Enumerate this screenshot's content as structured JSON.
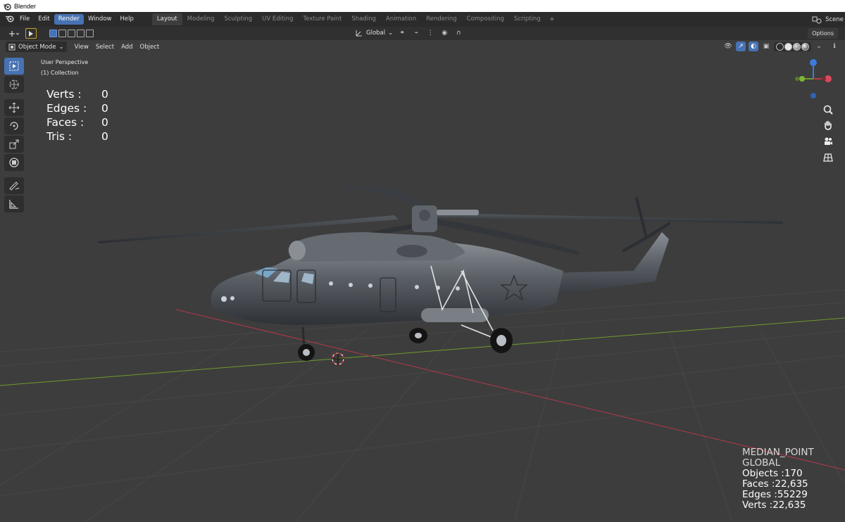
{
  "window": {
    "title": "Blender"
  },
  "topbar": {
    "menus": [
      "File",
      "Edit",
      "Render",
      "Window",
      "Help"
    ],
    "active_menu": "Render",
    "workspaces": [
      "Layout",
      "Modeling",
      "Sculpting",
      "UV Editing",
      "Texture Paint",
      "Shading",
      "Animation",
      "Rendering",
      "Compositing",
      "Scripting"
    ],
    "active_workspace": "Layout",
    "scene_label": "Scene"
  },
  "toolheader": {
    "transform_orientation": "Global",
    "options_label": "Options"
  },
  "viewport_header": {
    "mode": "Object Mode",
    "menus": [
      "View",
      "Select",
      "Add",
      "Object"
    ]
  },
  "viewport": {
    "perspective_label": "User Perspective",
    "collection_label": "(1) Collection",
    "stats": [
      {
        "key": "Verts :",
        "value": "0"
      },
      {
        "key": "Edges :",
        "value": "0"
      },
      {
        "key": "Faces :",
        "value": "0"
      },
      {
        "key": "Tris :",
        "value": "0"
      }
    ],
    "scene_stats": {
      "pivot": "MEDIAN_POINT",
      "orientation": "GLOBAL",
      "objects": "Objects :170",
      "faces": "Faces :22,635",
      "edges": "Edges :55229",
      "verts": "Verts :22,635"
    }
  },
  "icons": {
    "toolbar": [
      "select-box-icon",
      "cursor-icon",
      "move-icon",
      "rotate-icon",
      "scale-icon",
      "transform-icon",
      "annotate-icon",
      "measure-icon"
    ],
    "nav": [
      "zoom-icon",
      "pan-hand-icon",
      "camera-icon",
      "grid-view-icon"
    ]
  },
  "colors": {
    "accent": "#4772b3",
    "viewport_bg": "#3d3d3d",
    "axis_x": "#b3394a",
    "axis_y": "#6e9a2d",
    "axis_z": "#3d7ad9"
  }
}
